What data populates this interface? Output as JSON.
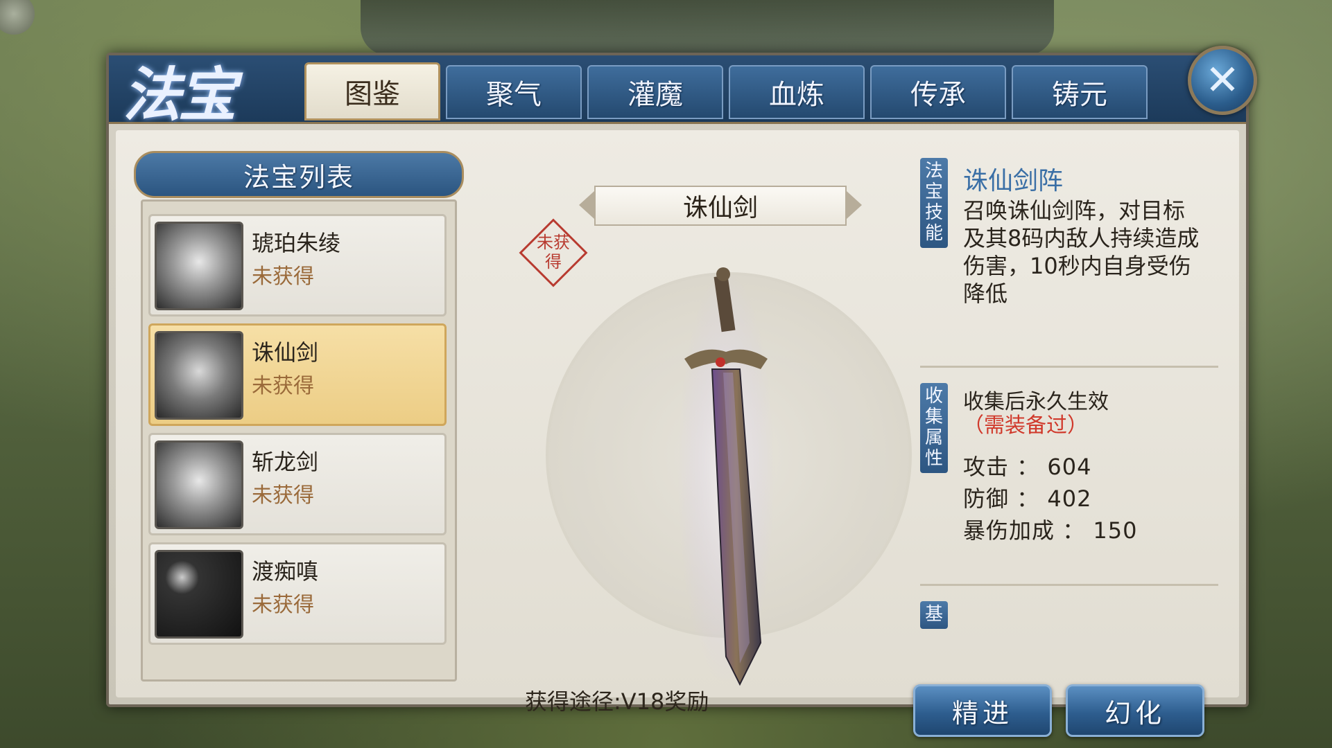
{
  "app": {
    "logo_text": "法宝"
  },
  "tabs": [
    {
      "label": "图鉴"
    },
    {
      "label": "聚气"
    },
    {
      "label": "灌魔"
    },
    {
      "label": "血炼"
    },
    {
      "label": "传承"
    },
    {
      "label": "铸元"
    }
  ],
  "close_icon": "close-icon",
  "list": {
    "header": "法宝列表",
    "items": [
      {
        "name": "琥珀朱绫",
        "status": "未获得"
      },
      {
        "name": "诛仙剑",
        "status": "未获得",
        "selected": true
      },
      {
        "name": "斩龙剑",
        "status": "未获得"
      },
      {
        "name": "渡痴嗔",
        "status": "未获得"
      }
    ]
  },
  "detail": {
    "name": "诛仙剑",
    "seal_text": "未获得",
    "obtain": "获得途径:V18奖励"
  },
  "skill": {
    "tag": "法宝技能",
    "name": "诛仙剑阵",
    "desc": "召唤诛仙剑阵，对目标及其8码内敌人持续造成伤害，10秒内自身受伤降低"
  },
  "collect": {
    "tag": "收集属性",
    "head": "收集后永久生效",
    "note": "（需装备过）",
    "attrs": [
      {
        "label": "攻击 ： 604"
      },
      {
        "label": "防御 ： 402"
      },
      {
        "label": "暴伤加成 ： 150"
      }
    ]
  },
  "base": {
    "tag": "基"
  },
  "buttons": {
    "refine": "精进",
    "transform": "幻化"
  }
}
